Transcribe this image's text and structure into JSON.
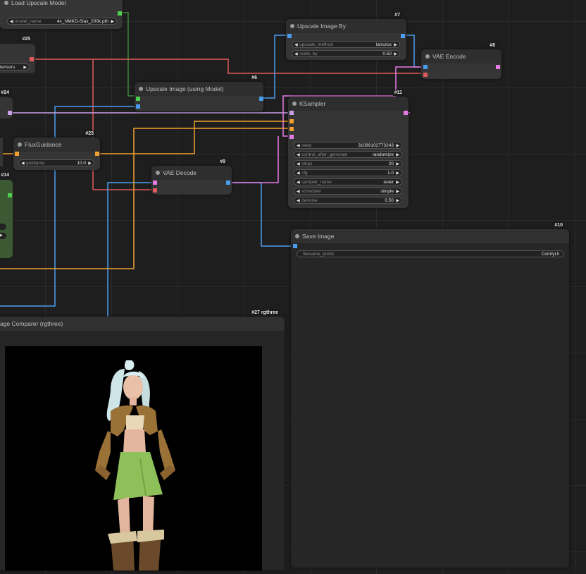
{
  "colors": {
    "canvas": "#1e1e1e",
    "node": "#353535",
    "image_link": "#4a9ef0",
    "latent_link": "#e57be5",
    "conditioning_link": "#f0a030",
    "vae_link": "#e05a5a",
    "upscale_model_link": "#4fcf4f"
  },
  "nodes": {
    "load_upscale_model": {
      "title": "Load Upscale Model",
      "widgets": [
        {
          "label": "model_name",
          "value": "4x_NMKD-Siax_200k.pth"
        }
      ]
    },
    "n25": {
      "badge": "#25",
      "widget_value": "tensors"
    },
    "n24": {
      "badge": "#24"
    },
    "n14": {
      "badge": "#14"
    },
    "upscale_image_by": {
      "badge": "#7",
      "title": "Upscale Image By",
      "widgets": [
        {
          "label": "upscale_method",
          "value": "lanczos"
        },
        {
          "label": "scale_by",
          "value": "0.50"
        }
      ]
    },
    "vae_encode": {
      "badge": "#8",
      "title": "VAE Encode"
    },
    "upscale_with_model": {
      "badge": "#6",
      "title": "Upscale Image (using Model)"
    },
    "ksampler": {
      "badge": "#11",
      "title": "KSampler",
      "widgets": [
        {
          "label": "seed",
          "value": "310891027732­43"
        },
        {
          "label": "control_after_generate",
          "value": "randomize"
        },
        {
          "label": "steps",
          "value": "20"
        },
        {
          "label": "cfg",
          "value": "1.0"
        },
        {
          "label": "sampler_name",
          "value": "euler"
        },
        {
          "label": "scheduler",
          "value": "simple"
        },
        {
          "label": "denoise",
          "value": "0.50"
        }
      ]
    },
    "flux_guidance": {
      "badge": "#23",
      "title": "FluxGuidance",
      "widgets": [
        {
          "label": "guidance",
          "value": "10.0"
        }
      ]
    },
    "vae_decode": {
      "badge": "#9",
      "title": "VAE Decode"
    },
    "save_image": {
      "badge": "#10",
      "title": "Save Image",
      "widgets": [
        {
          "label": "filename_prefix",
          "value": "ComfyUI"
        }
      ]
    },
    "image_comparer": {
      "badge": "#27 rgthree",
      "title": "age Comparer (rgthree)"
    }
  }
}
